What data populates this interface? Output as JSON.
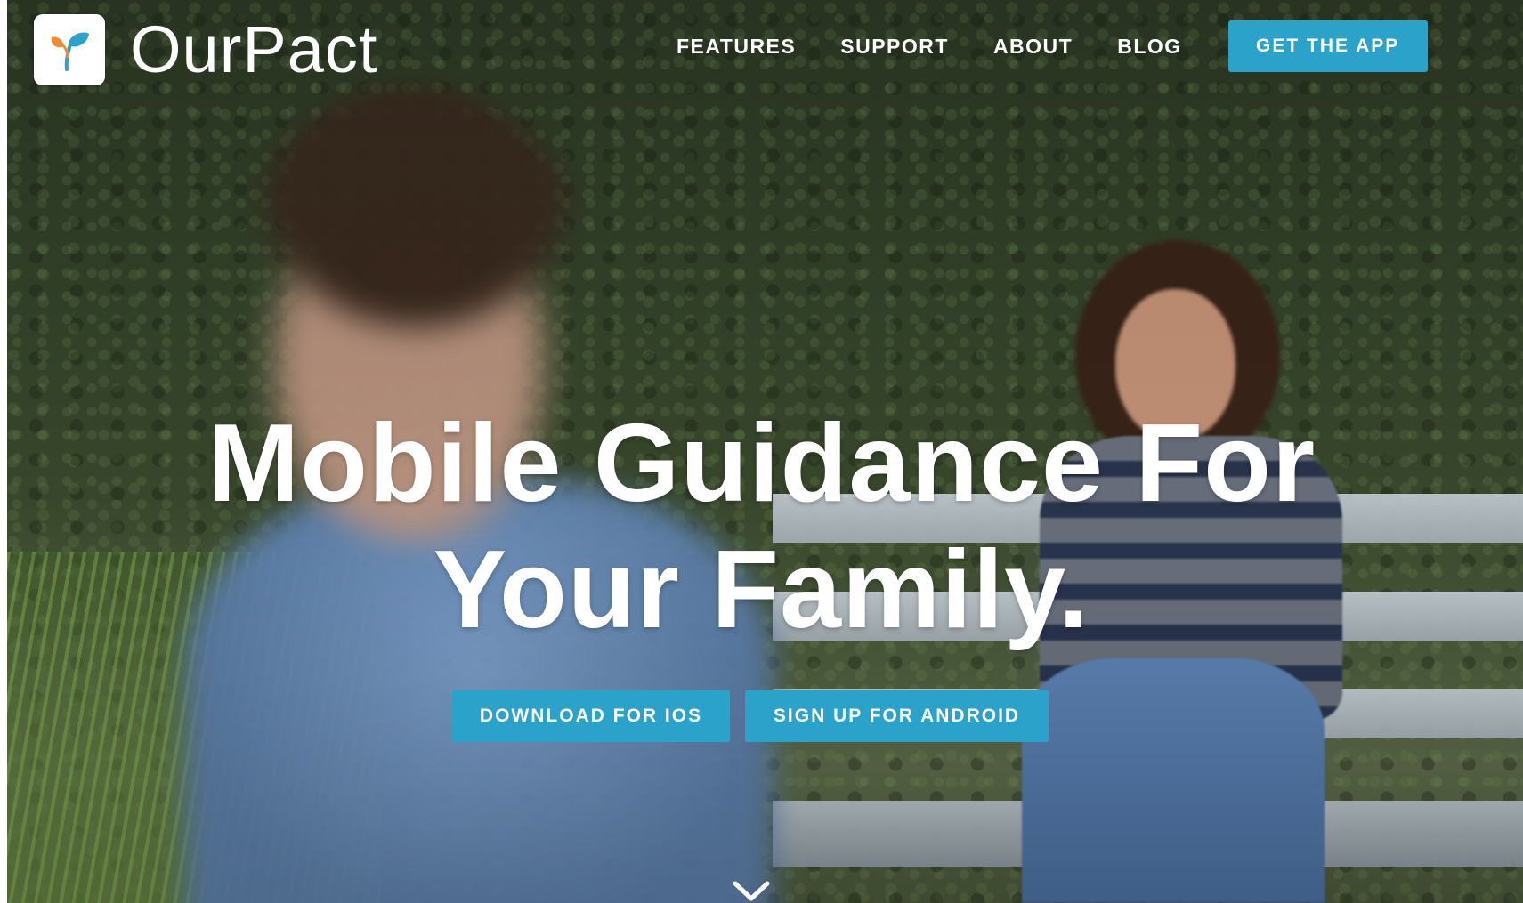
{
  "brand": {
    "name": "OurPact",
    "accent_color": "#2aa2c9",
    "logo_icon": "leaf-icon"
  },
  "nav": {
    "items": [
      {
        "label": "FEATURES"
      },
      {
        "label": "SUPPORT"
      },
      {
        "label": "ABOUT"
      },
      {
        "label": "BLOG"
      }
    ],
    "cta_label": "GET THE APP"
  },
  "hero": {
    "headline_line1": "Mobile Guidance For",
    "headline_line2": "Your Family.",
    "buttons": {
      "ios_label": "DOWNLOAD FOR IOS",
      "android_label": "SIGN UP FOR ANDROID"
    },
    "scroll_icon": "chevron-down-icon"
  }
}
